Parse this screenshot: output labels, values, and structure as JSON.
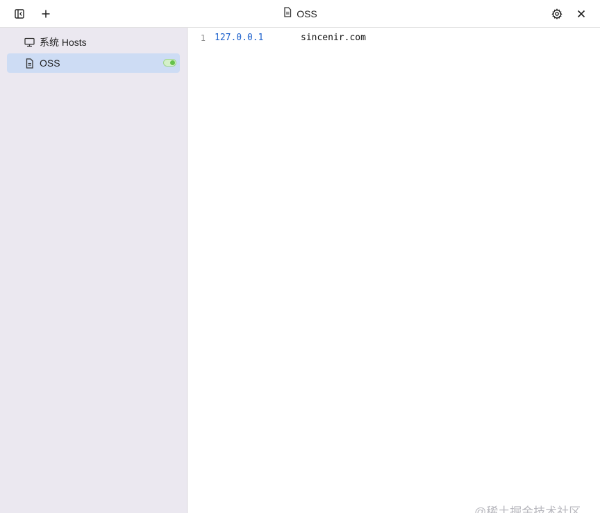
{
  "titlebar": {
    "title": "OSS",
    "toggle_sidebar_icon": "sidebar-toggle-icon",
    "add_icon": "plus-icon",
    "settings_icon": "gear-icon",
    "close_icon": "close-icon"
  },
  "sidebar": {
    "items": [
      {
        "label": "系统 Hosts",
        "icon": "monitor-icon",
        "selected": false
      },
      {
        "label": "OSS",
        "icon": "file-icon",
        "selected": true,
        "enabled": true
      }
    ]
  },
  "editor": {
    "lines": [
      {
        "number": "1",
        "ip": "127.0.0.1",
        "host": "sincenir.com"
      }
    ]
  },
  "watermark": "@稀土掘金技术社区",
  "colors": {
    "sidebar_bg": "#ebe8f0",
    "selected_bg": "#cddcf4",
    "ip_color": "#1a5fcc",
    "toggle_on": "#66c24a"
  }
}
